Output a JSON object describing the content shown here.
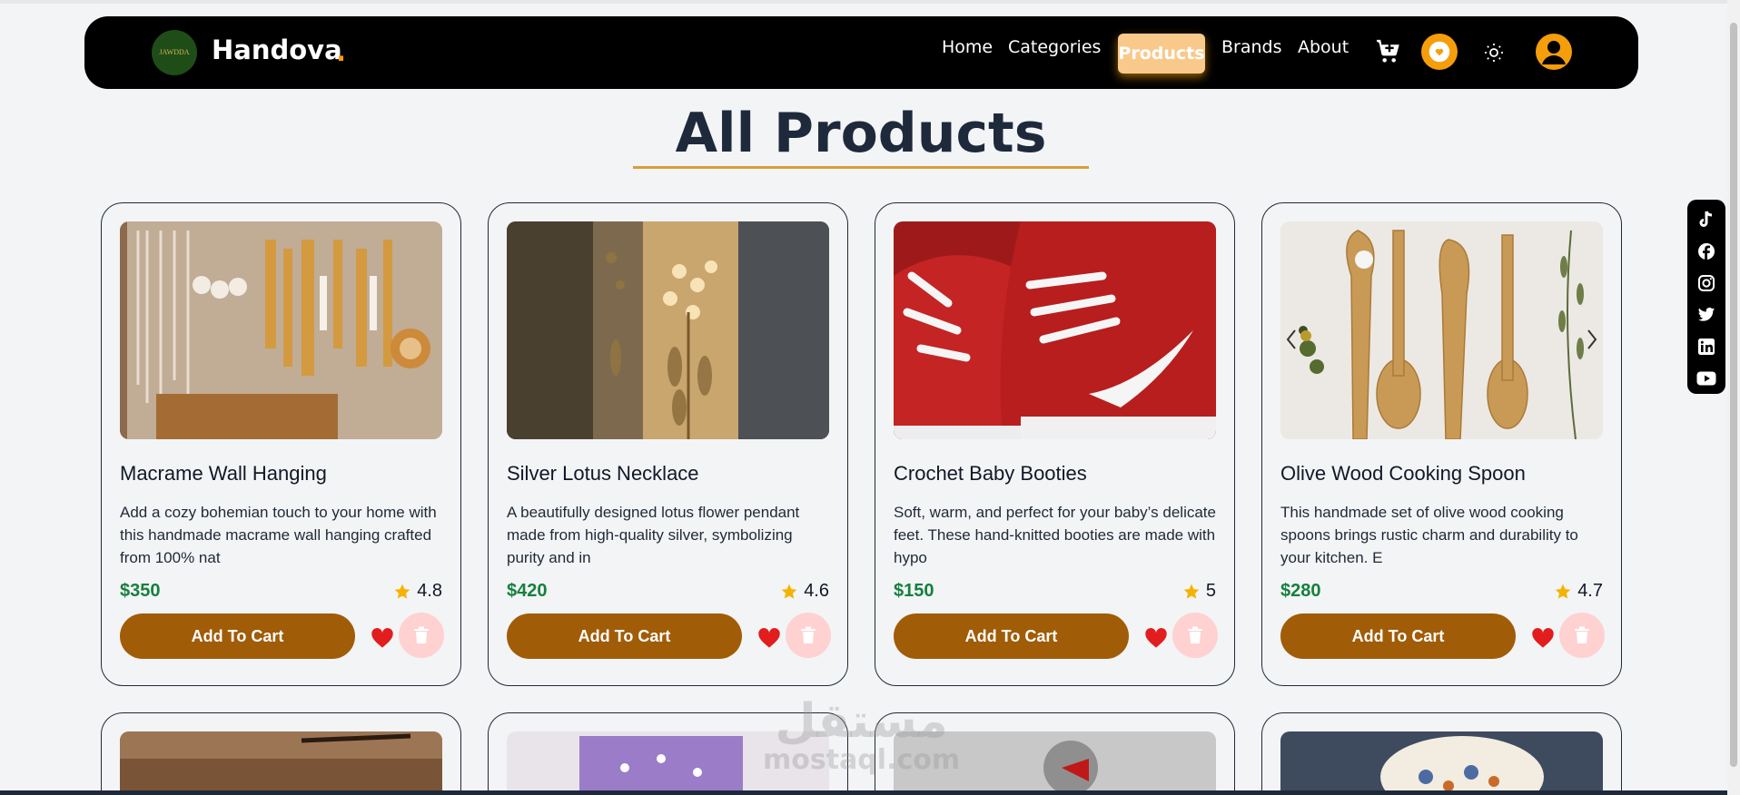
{
  "navbar": {
    "logo_text": "JAWDDA",
    "brand": "Handova",
    "brand_dot": ".",
    "links": [
      "Home",
      "Categories",
      "Products",
      "Brands",
      "About"
    ],
    "active": "Products"
  },
  "page": {
    "title": "All Products"
  },
  "products": [
    {
      "title": "Macrame Wall Hanging",
      "description": "Add a cozy bohemian touch to your home with this handmade macrame wall hanging crafted from 100% nat",
      "price": "$350",
      "rating": "4.8",
      "button": "Add To Cart"
    },
    {
      "title": "Silver Lotus Necklace",
      "description": "A beautifully designed lotus flower pendant made from high-quality silver, symbolizing purity and in",
      "price": "$420",
      "rating": "4.6",
      "button": "Add To Cart"
    },
    {
      "title": "Crochet Baby Booties",
      "description": "Soft, warm, and perfect for your baby’s delicate feet. These hand-knitted booties are made with hypo",
      "price": "$150",
      "rating": "5",
      "button": "Add To Cart"
    },
    {
      "title": "Olive Wood Cooking Spoon",
      "description": "This handmade set of olive wood cooking spoons brings rustic charm and durability to your kitchen. E",
      "price": "$280",
      "rating": "4.7",
      "button": "Add To Cart"
    }
  ],
  "social": [
    "tiktok-icon",
    "facebook-icon",
    "instagram-icon",
    "twitter-icon",
    "linkedin-icon",
    "youtube-icon"
  ],
  "watermark": {
    "line1": "مستقل",
    "line2": "mostaql.com"
  },
  "colors": {
    "accent": "#f59e0b",
    "button": "#a15c07",
    "price": "#15803d",
    "heart": "#e11d1d"
  }
}
